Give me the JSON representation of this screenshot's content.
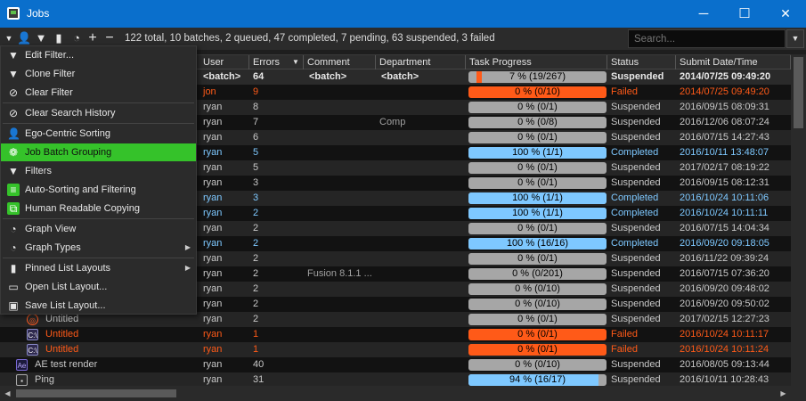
{
  "window": {
    "title": "Jobs",
    "minimize": "─",
    "maximize": "☐",
    "close": "✕"
  },
  "toolbar": {
    "summary": "122 total, 10 batches, 2 queued, 47 completed, 7 pending, 63 suspended, 3 failed",
    "search_placeholder": "Search..."
  },
  "columns": {
    "user": "User",
    "errors": "Errors",
    "comment": "Comment",
    "department": "Department",
    "progress": "Task Progress",
    "status": "Status",
    "date": "Submit Date/Time"
  },
  "colors": {
    "completed": "#7ec8ff",
    "failed": "#ff5a18",
    "suspended": "#a6a6a6",
    "selected": "#35c22a",
    "title": "#0a6fcc"
  },
  "menu": [
    {
      "label": "Edit Filter...",
      "icon": "filter-edit-icon"
    },
    {
      "label": "Clone Filter",
      "icon": "filter-clone-icon"
    },
    {
      "label": "Clear Filter",
      "icon": "filter-clear-icon"
    },
    {
      "label": "Clear Search History",
      "icon": "clear-search-icon"
    },
    {
      "label": "Ego-Centric Sorting",
      "icon": "user-icon"
    },
    {
      "label": "Job Batch Grouping",
      "icon": "batch-icon"
    },
    {
      "label": "Filters",
      "icon": "filter-icon"
    },
    {
      "label": "Auto-Sorting and Filtering",
      "icon": "auto-sort-icon"
    },
    {
      "label": "Human Readable Copying",
      "icon": "copy-icon"
    },
    {
      "label": "Graph View",
      "icon": "pie-chart-icon"
    },
    {
      "label": "Graph Types",
      "icon": "pie-chart-icon"
    },
    {
      "label": "Pinned List Layouts",
      "icon": "bookmark-icon"
    },
    {
      "label": "Open List Layout...",
      "icon": "folder-open-icon"
    },
    {
      "label": "Save List Layout...",
      "icon": "save-icon"
    }
  ],
  "rows": [
    {
      "name": "",
      "user": "<batch>",
      "errors": "64",
      "comment": "<batch>",
      "department": "<batch>",
      "progress": "7 %  (19/267)",
      "pct": 7,
      "status": "Suspended",
      "date": "2014/07/25 09:49:20",
      "type": "batch"
    },
    {
      "name": "",
      "user": "jon",
      "errors": "9",
      "comment": "",
      "department": "",
      "progress": "0 %  (0/10)",
      "pct": 0,
      "status": "Failed",
      "date": "2014/07/25 09:49:20",
      "type": "failed"
    },
    {
      "name": "",
      "user": "ryan",
      "errors": "8",
      "comment": "",
      "department": "",
      "progress": "0 %  (0/1)",
      "pct": 0,
      "status": "Suspended",
      "date": "2016/09/15 08:09:31",
      "type": "suspended"
    },
    {
      "name": "",
      "user": "ryan",
      "errors": "7",
      "comment": "",
      "department": "Comp",
      "progress": "0 %  (0/8)",
      "pct": 0,
      "status": "Suspended",
      "date": "2016/12/06 08:07:24",
      "type": "suspended"
    },
    {
      "name": "",
      "user": "ryan",
      "errors": "6",
      "comment": "",
      "department": "",
      "progress": "0 %  (0/1)",
      "pct": 0,
      "status": "Suspended",
      "date": "2016/07/15 14:27:43",
      "type": "suspended"
    },
    {
      "name": "",
      "user": "ryan",
      "errors": "5",
      "comment": "",
      "department": "",
      "progress": "100 %  (1/1)",
      "pct": 100,
      "status": "Completed",
      "date": "2016/10/11 13:48:07",
      "type": "completed"
    },
    {
      "name": "",
      "user": "ryan",
      "errors": "5",
      "comment": "",
      "department": "",
      "progress": "0 %  (0/1)",
      "pct": 0,
      "status": "Suspended",
      "date": "2017/02/17 08:19:22",
      "type": "suspended"
    },
    {
      "name": "",
      "user": "ryan",
      "errors": "3",
      "comment": "",
      "department": "",
      "progress": "0 %  (0/1)",
      "pct": 0,
      "status": "Suspended",
      "date": "2016/09/15 08:12:31",
      "type": "suspended"
    },
    {
      "name": "",
      "user": "ryan",
      "errors": "3",
      "comment": "",
      "department": "",
      "progress": "100 %  (1/1)",
      "pct": 100,
      "status": "Completed",
      "date": "2016/10/24 10:11:06",
      "type": "completed"
    },
    {
      "name": "",
      "user": "ryan",
      "errors": "2",
      "comment": "",
      "department": "",
      "progress": "100 %  (1/1)",
      "pct": 100,
      "status": "Completed",
      "date": "2016/10/24 10:11:11",
      "type": "completed"
    },
    {
      "name": "",
      "user": "ryan",
      "errors": "2",
      "comment": "",
      "department": "",
      "progress": "0 %  (0/1)",
      "pct": 0,
      "status": "Suspended",
      "date": "2016/07/15 14:04:34",
      "type": "suspended"
    },
    {
      "name": "",
      "user": "ryan",
      "errors": "2",
      "comment": "",
      "department": "",
      "progress": "100 %  (16/16)",
      "pct": 100,
      "status": "Completed",
      "date": "2016/09/20 09:18:05",
      "type": "completed"
    },
    {
      "name": "",
      "user": "ryan",
      "errors": "2",
      "comment": "",
      "department": "",
      "progress": "0 %  (0/1)",
      "pct": 0,
      "status": "Suspended",
      "date": "2016/11/22 09:39:24",
      "type": "suspended"
    },
    {
      "name": "",
      "user": "ryan",
      "errors": "2",
      "comment": "Fusion 8.1.1 ...",
      "department": "",
      "progress": "0 %  (0/201)",
      "pct": 0,
      "status": "Suspended",
      "date": "2016/07/15 07:36:20",
      "type": "suspended"
    },
    {
      "name": "",
      "user": "ryan",
      "errors": "2",
      "comment": "",
      "department": "",
      "progress": "0 %  (0/10)",
      "pct": 0,
      "status": "Suspended",
      "date": "2016/09/20 09:48:02",
      "type": "suspended"
    },
    {
      "name": "",
      "user": "ryan",
      "errors": "2",
      "comment": "",
      "department": "",
      "progress": "0 %  (0/10)",
      "pct": 0,
      "status": "Suspended",
      "date": "2016/09/20 09:50:02",
      "type": "suspended"
    },
    {
      "name": "Untitled",
      "user": "ryan",
      "errors": "2",
      "comment": "",
      "department": "",
      "progress": "0 %  (0/1)",
      "pct": 0,
      "status": "Suspended",
      "date": "2017/02/15 12:27:23",
      "type": "suspended",
      "icon": "nuke-icon",
      "ind": 30
    },
    {
      "name": "Untitled",
      "user": "ryan",
      "errors": "1",
      "comment": "",
      "department": "",
      "progress": "0 %  (0/1)",
      "pct": 0,
      "status": "Failed",
      "date": "2016/10/24 10:11:17",
      "type": "failed",
      "icon": "cmd-icon",
      "ind": 30
    },
    {
      "name": "Untitled",
      "user": "ryan",
      "errors": "1",
      "comment": "",
      "department": "",
      "progress": "0 %  (0/1)",
      "pct": 0,
      "status": "Failed",
      "date": "2016/10/24 10:11:24",
      "type": "failed",
      "icon": "cmd-icon",
      "ind": 30
    },
    {
      "name": "AE test render",
      "user": "ryan",
      "errors": "40",
      "comment": "",
      "department": "",
      "progress": "0 %  (0/10)",
      "pct": 0,
      "status": "Suspended",
      "date": "2016/08/05 09:13:44",
      "type": "suspended",
      "icon": "ae-icon",
      "ind": 18
    },
    {
      "name": "Ping",
      "user": "ryan",
      "errors": "31",
      "comment": "",
      "department": "",
      "progress": "94 %  (16/17)",
      "pct": 94,
      "status": "Suspended",
      "date": "2016/10/11 10:28:43",
      "type": "suspended",
      "icon": "ping-icon",
      "ind": 18
    }
  ]
}
